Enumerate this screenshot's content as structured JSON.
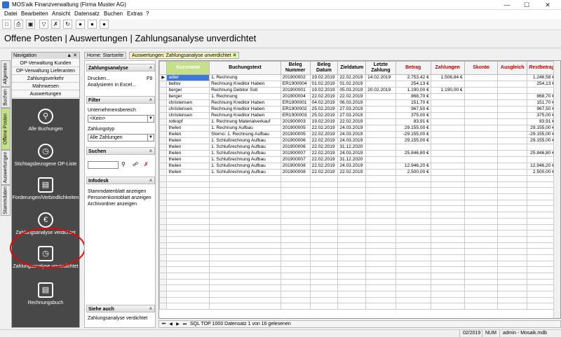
{
  "window": {
    "title": "MOS'aik Finanzverwaltung (Firma Muster AG)"
  },
  "menu": [
    "Datei",
    "Bearbeiten",
    "Ansicht",
    "Datensatz",
    "Buchen",
    "Extras",
    "?"
  ],
  "page_title": "Offene Posten | Auswertungen | Zahlungsanalyse unverdichtet",
  "nav": {
    "header": "Navigation",
    "rows": [
      "OP-Verwaltung Kunden",
      "OP-Verwaltung Lieferanten",
      "Zahlungsverkehr",
      "Mahnwesen",
      "Auswertungen"
    ],
    "big": [
      {
        "label": "Alle Buchungen",
        "icon": "search-icon"
      },
      {
        "label": "Stichtagsbezogene OP-Liste",
        "icon": "clock-icon"
      },
      {
        "label": "Forderungen/Verbindlichkeiten",
        "icon": "money-icon"
      },
      {
        "label": "Zahlungsanalyse verdichtet",
        "icon": "euro-icon"
      },
      {
        "label": "Zahlungsanalyse unverdichtet",
        "icon": "folder-clock-icon"
      },
      {
        "label": "Rechnungsbuch",
        "icon": "document-icon"
      }
    ],
    "vtabs": [
      "Allgemein",
      "Buchen",
      "Offene Posten",
      "Auswertungen",
      "Stammdaten"
    ]
  },
  "tabs": {
    "home": "Home: Startseite",
    "active": "Auswertungen: Zahlungsanalyse unverdichtet"
  },
  "panel": {
    "zahlungsanalyse": {
      "title": "Zahlungsanalyse",
      "item1": "Drucken...",
      "item1_key": "F9",
      "item2": "Analysieren in Excel..."
    },
    "filter": {
      "title": "Filter",
      "label1": "Unternehmensbereich",
      "value1": "<Kein>",
      "label2": "Zahlungstyp",
      "value2": "Alle Zahlungen"
    },
    "suchen": {
      "title": "Suchen"
    },
    "infodesk": {
      "title": "Infodesk",
      "items": [
        "Stammdatenblatt anzeigen",
        "Personenkontoblatt anzeigen",
        "Archivordner anzeigen"
      ]
    },
    "siehe": {
      "title": "Siehe auch",
      "item": "Zahlungsanalyse verdichtet"
    }
  },
  "grid": {
    "headers": [
      "Kurzname",
      "Buchungstext",
      "Beleg Nummer",
      "Beleg Datum",
      "Zieldatum",
      "Letzte Zahlung",
      "Betrag",
      "Zahlungen",
      "Skonto",
      "Ausgleich",
      "Restbetrag"
    ],
    "rows": [
      [
        "adler",
        "1. Rechnung",
        "201900002",
        "19.02.2019",
        "22.02.2019",
        "14.02.2019",
        "2.753,42 €",
        "1.506,84 €",
        "",
        "",
        "1.246,58 €"
      ],
      [
        "bellov",
        "Rechnung Kreditor Haben",
        "ER1900004",
        "01.02.2019",
        "01.02.2019",
        "",
        "254,13 €",
        "",
        "",
        "",
        "254,13 €"
      ],
      [
        "berger",
        "Rechnung Debitor Soll",
        "201900001",
        "19.02.2019",
        "05.03.2019",
        "20.02.2019",
        "1.190,00 €",
        "1.190,00 €",
        "",
        "",
        ""
      ],
      [
        "berger",
        "1. Rechnung",
        "201900004",
        "22.02.2019",
        "22.02.2019",
        "",
        "868,70 €",
        "",
        "",
        "",
        "868,70 €"
      ],
      [
        "christensen",
        "Rechnung Kreditor Haben",
        "ER1900001",
        "04.02.2019",
        "06.03.2019",
        "",
        "151,70 €",
        "",
        "",
        "",
        "151,70 €"
      ],
      [
        "christensen",
        "Rechnung Kreditor Haben",
        "ER1900002",
        "25.02.2019",
        "27.03.2019",
        "",
        "967,50 €",
        "",
        "",
        "",
        "967,50 €"
      ],
      [
        "christensen",
        "Rechnung Kreditor Haben",
        "ER1900003",
        "25.02.2019",
        "27.03.2019",
        "",
        "375,00 €",
        "",
        "",
        "",
        "375,00 €"
      ],
      [
        "rotkopf",
        "1. Rechnung Materialverkauf",
        "201900003",
        "19.02.2019",
        "22.02.2019",
        "",
        "83,91 €",
        "",
        "",
        "",
        "83,91 €"
      ],
      [
        "thelen",
        "1. Rechnung Aufbau",
        "201900005",
        "22.02.2019",
        "24.03.2019",
        "",
        "29.155,00 €",
        "",
        "",
        "",
        "29.155,00 €"
      ],
      [
        "thelen",
        "Storno: 1. Rechnung Aufbau",
        "201900005",
        "22.02.2019",
        "24.03.2019",
        "",
        "-29.155,00 €",
        "",
        "",
        "",
        "-29.155,00 €"
      ],
      [
        "thelen",
        "1. Schlußrechnung Aufbau",
        "201900006",
        "22.02.2019",
        "24.03.2019",
        "",
        "29.155,00 €",
        "",
        "",
        "",
        "29.155,00 €"
      ],
      [
        "thelen",
        "1. Schlußrechnung Aufbau",
        "201900006",
        "22.02.2019",
        "31.12.2020",
        "",
        "",
        "",
        "",
        "",
        ""
      ],
      [
        "thelen",
        "1. Schlußrechnung Aufbau",
        "201900007",
        "22.02.2019",
        "24.03.2019",
        "",
        "25.846,80 €",
        "",
        "",
        "",
        "25.846,80 €"
      ],
      [
        "thelen",
        "1. Schlußrechnung Aufbau",
        "201900007",
        "22.02.2019",
        "31.12.2020",
        "",
        "",
        "",
        "",
        "",
        ""
      ],
      [
        "thelen",
        "1. Schlußrechnung Aufbau",
        "201900008",
        "22.02.2019",
        "24.03.2019",
        "",
        "12.946,20 €",
        "",
        "",
        "",
        "12.946,20 €"
      ],
      [
        "thelen",
        "1. Schlußrechnung Aufbau",
        "201900008",
        "22.02.2019",
        "22.02.2019",
        "",
        "2.500,00 €",
        "",
        "",
        "",
        "2.500,00 €"
      ]
    ],
    "record_info": "SQL TOP 1000 Datensatz 1 von 16 gelesenen"
  },
  "status": {
    "period": "02/2019",
    "num": "NUM",
    "user": "admin - Mosaik.mdb"
  },
  "colors": {
    "accent_green": "#c6e08a",
    "red_header": "#c00000",
    "nav_dark": "#484848",
    "highlight": "#e00000"
  }
}
